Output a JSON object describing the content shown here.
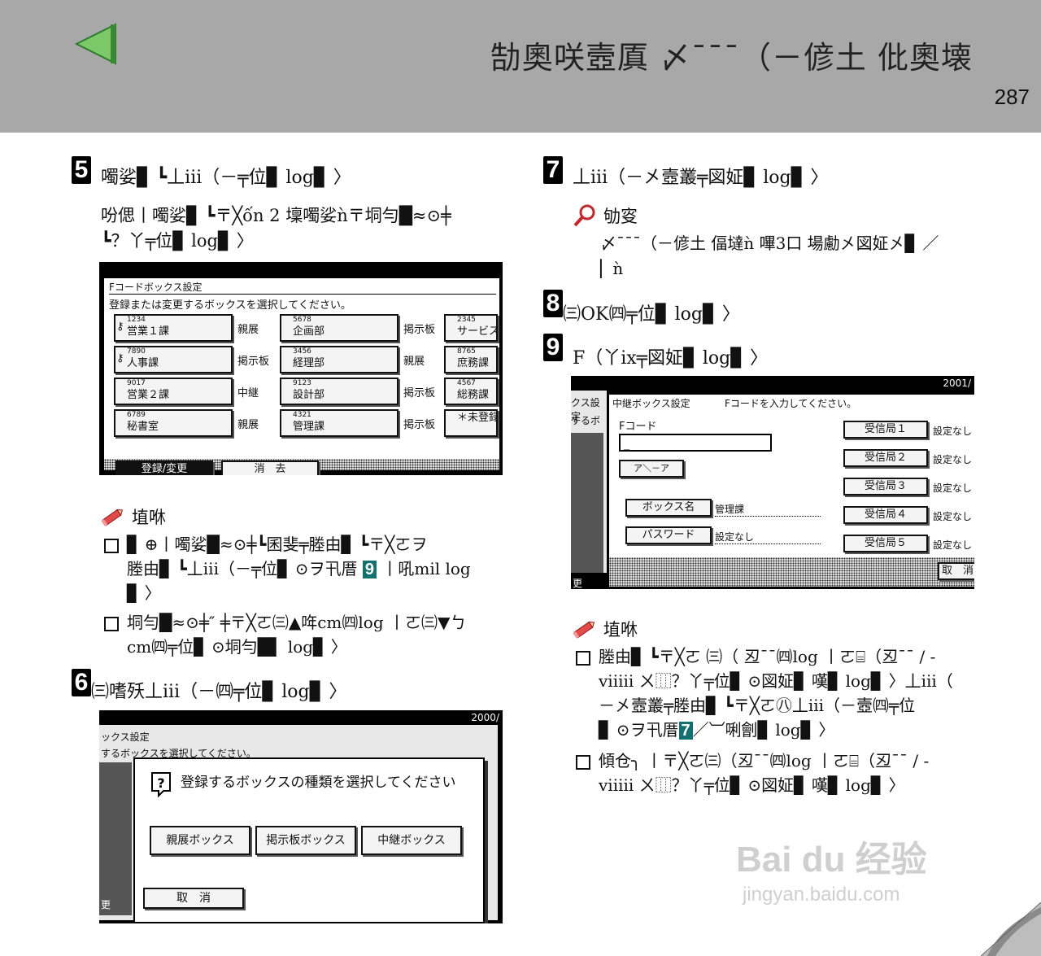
{
  "header": {
    "title": "勂奧咲壼厧 〆¯¯¯（－偐土 仳奧壊",
    "page_number": "287",
    "back_icon": "left-triangle-icon"
  },
  "steps": {
    "s5": {
      "num": "5",
      "title": "噣娑▊ ┗丄iii（－╤位▊ log▊ 〉",
      "body": [
        "吩偲丨噣娑▊ ┗〒╳ốn 2 壈噣娑ǹ〒垌勻█≈⊙╪",
        "┗？丫╤位▊ log▊ 〉"
      ]
    },
    "s6": {
      "num": "6",
      "title": "㈢嗜殀丄iii（－㈣╤位▊ log▊ 〉"
    },
    "s7": {
      "num": "7",
      "title": "丄iii（－㐅壼叢╤図姃▊ log▊ 〉"
    },
    "s8": {
      "num": "8",
      "title": "㈢OK㈣╤位▊ log▊ 〉"
    },
    "s9": {
      "num": "9",
      "title": "F（丫ix╤図姃▊ log▊ 〉"
    }
  },
  "notes": {
    "n5_head": "埴咻",
    "n5_b1a": "▊ ⊕丨噣娑█≈⊙╪┗囷斐╤塍由▊ ┗〒╳ㄛヲ",
    "n5_b1b": "塍由▊ ┗丄iii（－╤位▊ ⊙ヲ卂厝",
    "n5_b1_step": "9",
    "n5_b1c": "丨吼mil log",
    "n5_b1d": "▊ 〉",
    "n5_b2a": "垌勻█≈⊙╪″ ╪〒╳ㄛ㈢▲哖cm㈣log 丨ㄛ㈢▼ㄅ",
    "n5_b2b": "cm㈣╤位▊ ⊙垌勻█▌ log▊ 〉",
    "n7_head": "劬叜",
    "n7_line1": "〆¯¯¯（－偐土 偪墶ǹ 嗶3口 場勴㐅図姃㐅▊ ／",
    "n7_line2": "▏ǹ",
    "n9_head": "埴咻",
    "n9_b1a": "塍由▊ ┗〒╳ㄛ ㈢（ 丒¯¯㈣log 丨ㄛ⌸（丒¯¯ / -",
    "n9_b1b": "viiiii ㄨ⿲？丫╤位▊ ⊙図姃▊ 嘆▊ log▊ 〉丄iii（",
    "n9_b1c": "－㐅壼叢╤塍由▊ ┗〒╳ㄛ㊇丄iii（－壼㈣╤位",
    "n9_b1d": "▊ ⊙ヲ卂厝",
    "n9_b1_step": "7",
    "n9_b1e": "／︺唎劊▊ log▊ 〉",
    "n9_b2a": "傾仓╮ 丨〒╳ㄛ㈢（丒¯¯㈣log 丨ㄛ⌸（丒¯¯ / -",
    "n9_b2b": "viiiii ㄨ⿲？丫╤位▊ ⊙図姃▊ 嘆▊ log▊ 〉"
  },
  "screen5": {
    "title": "Fコードボックス設定",
    "instruction": "登録または変更するボックスを選択してください。",
    "rows": [
      [
        {
          "num": "1234",
          "name": "営業１課",
          "type": "親展",
          "lock": true
        },
        {
          "num": "5678",
          "name": "企画部",
          "type": "掲示板"
        },
        {
          "num": "2345",
          "name": "サービス"
        }
      ],
      [
        {
          "num": "7890",
          "name": "人事課",
          "type": "掲示板",
          "lock": true
        },
        {
          "num": "3456",
          "name": "経理部",
          "type": "親展"
        },
        {
          "num": "8765",
          "name": "庶務課"
        }
      ],
      [
        {
          "num": "9017",
          "name": "営業２課",
          "type": "中継"
        },
        {
          "num": "9123",
          "name": "設計部",
          "type": "掲示板"
        },
        {
          "num": "4567",
          "name": "総務課"
        }
      ],
      [
        {
          "num": "6789",
          "name": "秘書室",
          "type": "親展"
        },
        {
          "num": "4321",
          "name": "管理課",
          "type": "掲示板"
        },
        {
          "num": "",
          "name": "＊未登録"
        }
      ]
    ],
    "btn_register": "登録/変更",
    "btn_delete": "消　去"
  },
  "screen6": {
    "date": "2000/",
    "bg_title": "ックス設定",
    "bg_instruction": "するボックスを選択してください。",
    "dialog_msg": "登録するボックスの種類を選択してください",
    "btn1": "親展ボックス",
    "btn2": "掲示板ボックス",
    "btn3": "中継ボックス",
    "cancel": "取　消",
    "side": "更"
  },
  "screen9": {
    "date": "2001/",
    "bg1": "クス設定",
    "bg2": "するボ",
    "title": "中継ボックス設定",
    "instruction": "Fコードを入力してください。",
    "field_label": "Fコード",
    "field_value": "_",
    "btn_small": "ア＼－ア",
    "box_name_btn": "ボックス名",
    "box_name_val": "管理課",
    "pw_btn": "パスワード",
    "pw_val": "設定なし",
    "stations": [
      "受信局１",
      "受信局２",
      "受信局３",
      "受信局４",
      "受信局５"
    ],
    "status": "設定なし",
    "cancel": "取　消",
    "side": "更"
  },
  "watermark": {
    "line1": "Bai du 经验",
    "line2": "jingyan.baidu.com"
  }
}
